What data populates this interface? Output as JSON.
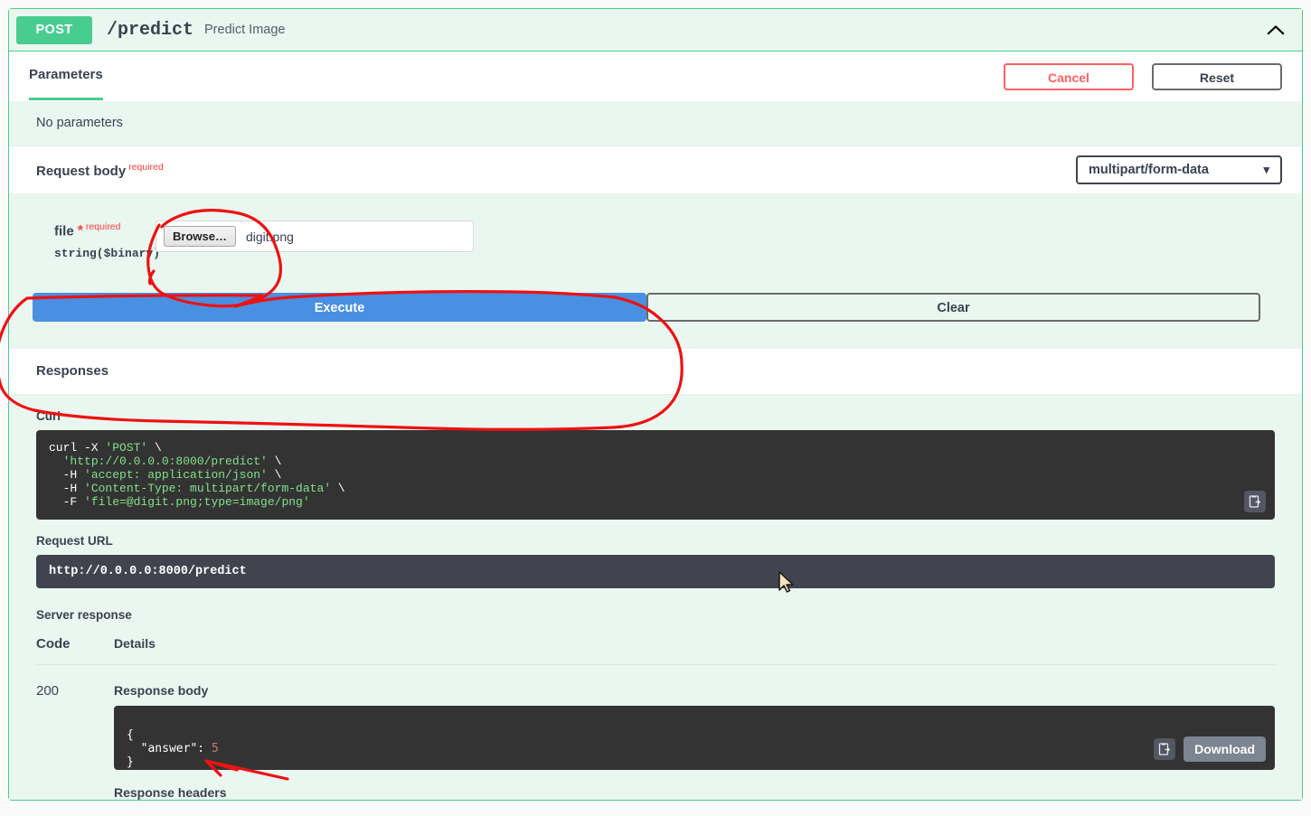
{
  "operation": {
    "method": "POST",
    "path": "/predict",
    "summary": "Predict Image",
    "collapse_icon": "chevron-up-icon"
  },
  "toolbar": {
    "parameters_tab": "Parameters",
    "cancel_label": "Cancel",
    "reset_label": "Reset"
  },
  "parameters": {
    "empty_text": "No parameters"
  },
  "request_body": {
    "title": "Request body",
    "required_label": "required",
    "media_type": "multipart/form-data",
    "caret_icon": "chevron-down-icon",
    "field": {
      "name": "file",
      "star": "*",
      "required_label": "required",
      "type": "string($binary)",
      "browse_label": "Browse…",
      "filename": "digit.png"
    }
  },
  "actions": {
    "execute_label": "Execute",
    "clear_label": "Clear"
  },
  "responses": {
    "heading": "Responses",
    "curl_label": "Curl",
    "curl_lines": [
      {
        "plain": "curl -X ",
        "green": "'POST'",
        "tail": " \\"
      },
      {
        "plain": "  ",
        "green": "'http://0.0.0.0:8000/predict'",
        "tail": " \\"
      },
      {
        "plain": "  -H ",
        "green": "'accept: application/json'",
        "tail": " \\"
      },
      {
        "plain": "  -H ",
        "green": "'Content-Type: multipart/form-data'",
        "tail": " \\"
      },
      {
        "plain": "  -F ",
        "green": "'file=@digit.png;type=image/png'",
        "tail": ""
      }
    ],
    "copy_icon": "copy-clipboard-icon",
    "request_url_label": "Request URL",
    "request_url": "http://0.0.0.0:8000/predict",
    "server_response_label": "Server response",
    "columns": {
      "code": "Code",
      "details": "Details"
    },
    "row": {
      "code": "200",
      "response_body_label": "Response body",
      "body_open": "{",
      "body_key": "\"answer\":",
      "body_value": "5",
      "body_close": "}",
      "download_label": "Download",
      "download_copy_icon": "copy-clipboard-icon",
      "response_headers_label": "Response headers"
    }
  },
  "colors": {
    "method_green": "#49cc90",
    "execute_blue": "#4990e2",
    "required_red": "#f93e3e",
    "cancel_red": "#ff6060",
    "code_bg": "#333333",
    "panel_bg": "#eaf7f0",
    "annotation_red": "#ee1111"
  },
  "annotations": {
    "circle_file_input": "hand-drawn-red-circle-around-file-picker",
    "circle_execute": "hand-drawn-red-ellipse-around-execute-button",
    "arrow_answer": "hand-drawn-red-arrow-pointing-at-answer-value"
  },
  "cursor": {
    "icon": "mouse-pointer-icon"
  }
}
